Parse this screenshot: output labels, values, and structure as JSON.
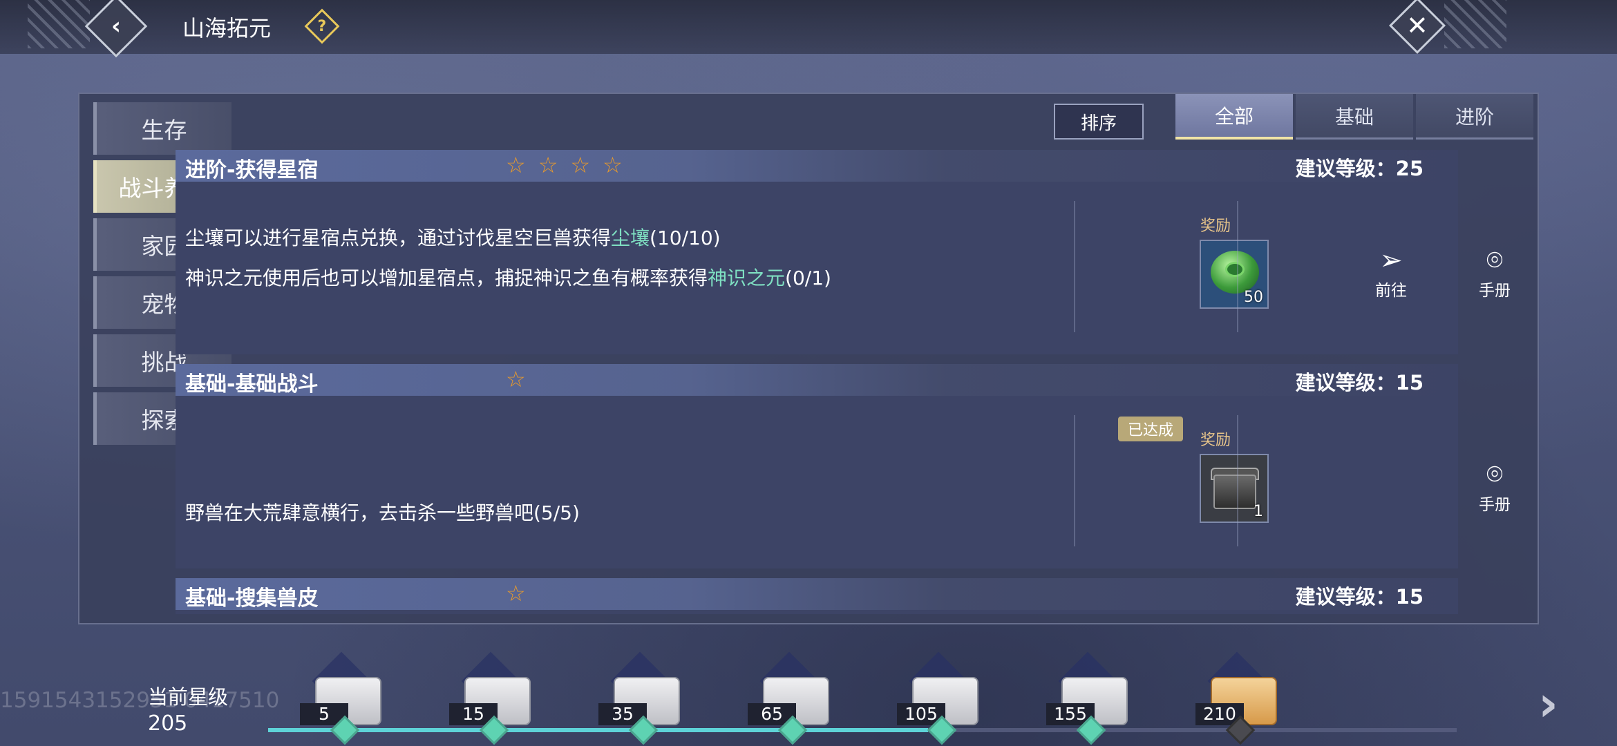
{
  "header": {
    "title": "山海拓元",
    "back_icon": "‹",
    "help_icon": "?",
    "close_icon": "✕"
  },
  "sidebar": {
    "items": [
      {
        "label": "生存"
      },
      {
        "label": "战斗养成",
        "active": true
      },
      {
        "label": "家园"
      },
      {
        "label": "宠物"
      },
      {
        "label": "挑战"
      },
      {
        "label": "探索"
      }
    ]
  },
  "toolbar": {
    "sort_label": "排序",
    "tabs": [
      {
        "label": "全部",
        "active": true
      },
      {
        "label": "基础"
      },
      {
        "label": "进阶"
      }
    ]
  },
  "quests": [
    {
      "title": "进阶-获得星宿",
      "stars": 4,
      "level_label": "建议等级：25",
      "desc1_pre": "尘壤可以进行星宿点兑换，通过讨伐星空巨兽获得",
      "desc1_hl": "尘壤",
      "desc1_post": "(10/10)",
      "desc2_pre": "神识之元使用后也可以增加星宿点，捕捉神识之鱼有概率获得",
      "desc2_hl": "神识之元",
      "desc2_post": "(0/1)",
      "reward_label": "奖励",
      "reward_count": "50",
      "goto_label": "前往",
      "manual_label": "手册"
    },
    {
      "title": "基础-基础战斗",
      "stars": 1,
      "level_label": "建议等级：15",
      "status_badge": "已达成",
      "desc1": "野兽在大荒肆意横行，去击杀一些野兽吧(5/5)",
      "reward_label": "奖励",
      "reward_count": "1",
      "manual_label": "手册"
    },
    {
      "title": "基础-搜集兽皮",
      "stars": 1,
      "level_label": "建议等级：15"
    }
  ],
  "progress": {
    "current_label": "当前星级",
    "current_value": "205",
    "watermark": "1591543152951·0417510",
    "filled_fraction": 0.555,
    "milestones": [
      "5",
      "15",
      "35",
      "65",
      "105",
      "155",
      "210"
    ],
    "next_icon": "›"
  },
  "icons": {
    "star": "☆",
    "send": "➢",
    "pin": "⌾"
  }
}
